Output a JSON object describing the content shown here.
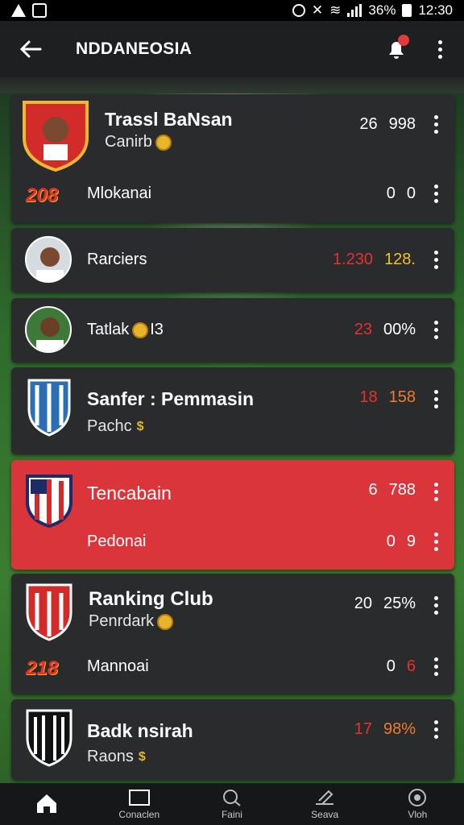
{
  "status_bar": {
    "battery": "36%",
    "time": "12:30"
  },
  "app_bar": {
    "title": "NDDANEOSIA"
  },
  "cards": [
    {
      "name": "Trassl BaNsan",
      "sub": "Canirb",
      "stats": [
        "26",
        "998"
      ],
      "rank": "208",
      "subname": "Mlokanai",
      "sub_stats": [
        "0",
        "0"
      ]
    },
    {
      "name": "Rarciers",
      "stats": [
        "1.230",
        "128."
      ]
    },
    {
      "name": "Tatlak",
      "suffix": "I3",
      "stats": [
        "23",
        "00%"
      ]
    },
    {
      "name": "Sanfer : Pemmasin",
      "sub": "Pachc",
      "stats": [
        "18",
        "158"
      ]
    },
    {
      "name": "Tencabain",
      "subname": "Pedonai",
      "stats": [
        "6",
        "788"
      ],
      "sub_stats": [
        "0",
        "9"
      ]
    },
    {
      "name": "Ranking Club",
      "sub": "Penrdark",
      "stats": [
        "20",
        "25%"
      ],
      "rank": "218",
      "subname": "Mannoai",
      "sub_stats": [
        "0",
        "6"
      ]
    },
    {
      "name": "Badk nsirah",
      "sub": "Raons",
      "stats": [
        "17",
        "98%"
      ]
    }
  ],
  "colors": {
    "card": "#2a2b2d",
    "highlight": "#d9353a",
    "accent_red": "#e5322e",
    "accent_yellow": "#f2c230"
  },
  "bottom_nav": [
    {
      "label": "",
      "icon": "home-icon"
    },
    {
      "label": "Conaclen",
      "icon": "square-icon"
    },
    {
      "label": "Faini",
      "icon": "search-icon"
    },
    {
      "label": "Seava",
      "icon": "edit-icon"
    },
    {
      "label": "Vloh",
      "icon": "ball-icon"
    }
  ]
}
